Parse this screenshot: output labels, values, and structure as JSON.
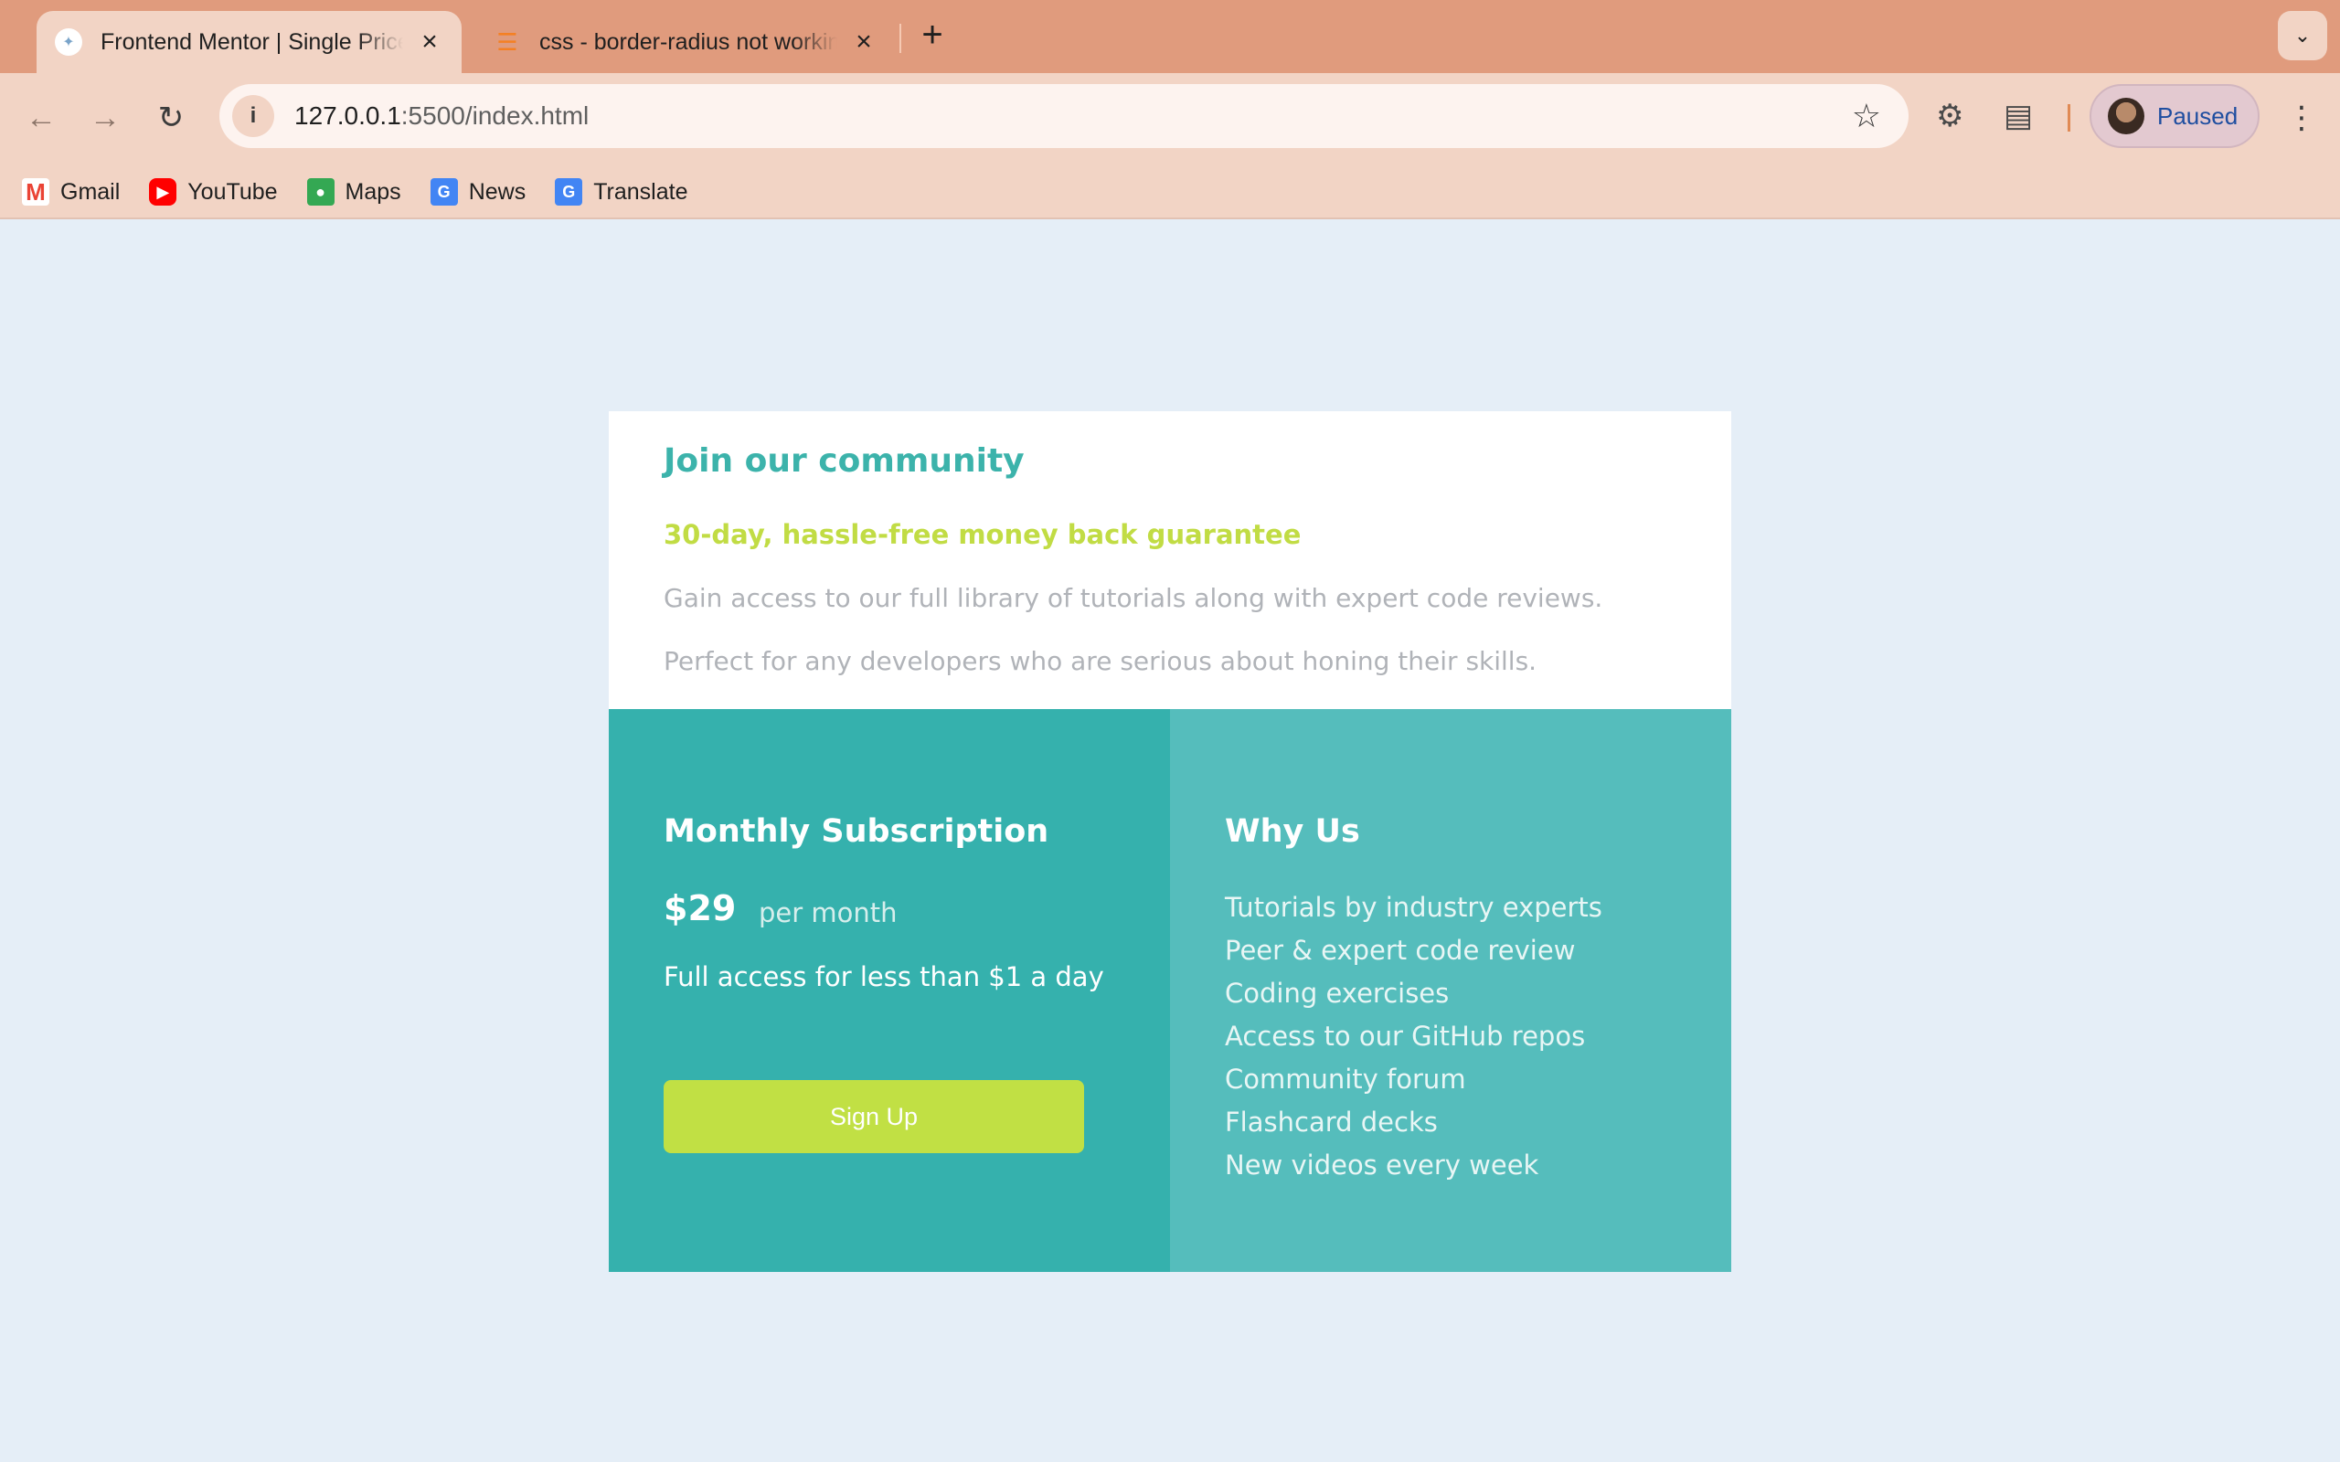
{
  "browser": {
    "tabs": [
      {
        "title": "Frontend Mentor | Single Price Grid Component",
        "active": true
      },
      {
        "title": "css - border-radius not working",
        "active": false
      }
    ],
    "new_tab_icon": "plus-icon",
    "url_host": "127.0.0.1",
    "url_rest": ":5500/index.html",
    "profile_status": "Paused",
    "bookmarks": [
      {
        "label": "Gmail",
        "icon": "gmail-icon"
      },
      {
        "label": "YouTube",
        "icon": "youtube-icon"
      },
      {
        "label": "Maps",
        "icon": "maps-icon"
      },
      {
        "label": "News",
        "icon": "news-icon"
      },
      {
        "label": "Translate",
        "icon": "translate-icon"
      }
    ]
  },
  "card": {
    "title": "Join our community",
    "subtitle": "30-day, hassle-free money back guarantee",
    "description_lines": [
      "Gain access to our full library of tutorials along with expert code reviews.",
      "Perfect for any developers who are serious about honing their skills."
    ],
    "subscription": {
      "title": "Monthly Subscription",
      "price": "$29",
      "period": "per month",
      "note": "Full access for less than $1 a day",
      "cta": "Sign Up"
    },
    "why": {
      "title": "Why Us",
      "items": [
        "Tutorials by industry experts",
        "Peer & expert code review",
        "Coding exercises",
        "Access to our GitHub repos",
        "Community forum",
        "Flashcard decks",
        "New videos every week"
      ]
    }
  },
  "colors": {
    "page_bg": "#e5eef7",
    "teal": "#35b1ad",
    "teal_light": "#55bdbc",
    "accent_yellow": "#c1dc44",
    "title_teal": "#3cb3ab",
    "chrome_tabstrip": "#e09b7d",
    "chrome_toolbar": "#f2d4c5"
  }
}
